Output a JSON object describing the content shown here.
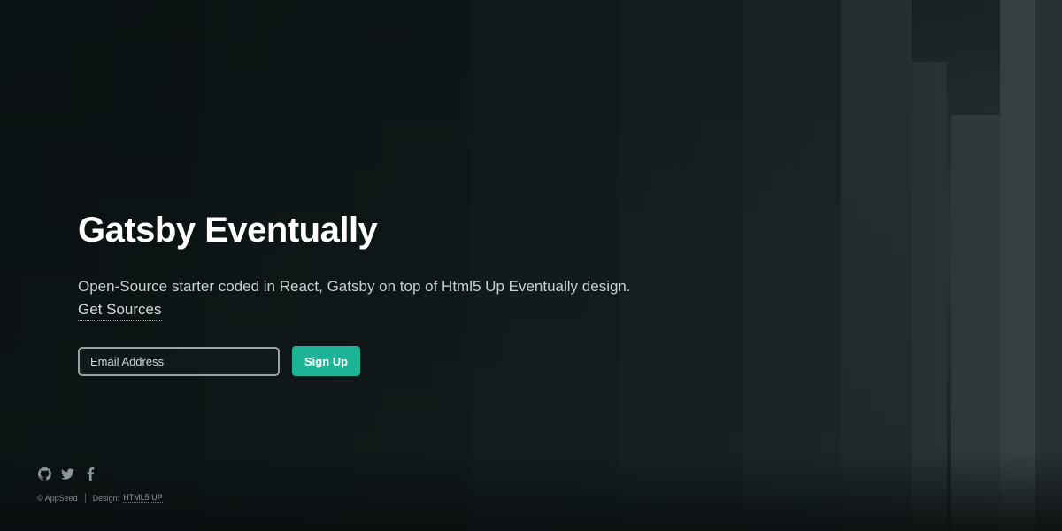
{
  "hero": {
    "title": "Gatsby Eventually",
    "description": "Open-Source starter coded in React, Gatsby on top of Html5 Up Eventually design.",
    "sources_link": "Get Sources"
  },
  "signup": {
    "email_placeholder": "Email Address",
    "button_label": "Sign Up"
  },
  "footer": {
    "social_icons": [
      "github-icon",
      "twitter-icon",
      "facebook-icon"
    ],
    "copyright": "© AppSeed",
    "design_label": "Design:",
    "design_link": "HTML5 UP"
  },
  "colors": {
    "accent": "#1cb495",
    "background": "#0e1516",
    "title_text": "#ffffff"
  }
}
